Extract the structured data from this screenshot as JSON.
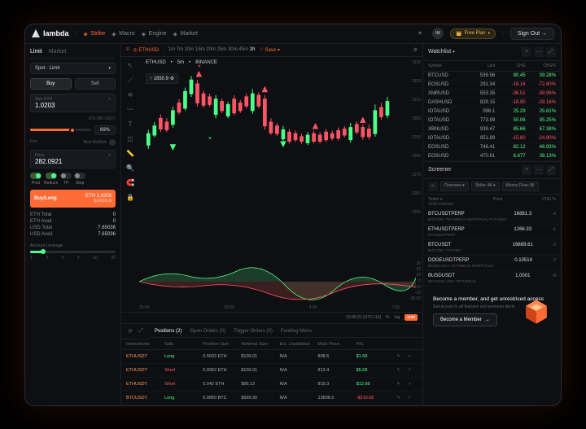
{
  "brand": "lambda",
  "nav": [
    {
      "label": "Strike",
      "active": true
    },
    {
      "label": "Macro"
    },
    {
      "label": "Engine"
    },
    {
      "label": "Market"
    }
  ],
  "user_initials": "IM",
  "plan_label": "Free Plan",
  "signout": "Sign Out",
  "order": {
    "tabs": [
      "Limit",
      "Market"
    ],
    "spot_label": "Spot · Limit",
    "buy": "Buy",
    "sell": "Sell",
    "size_label": "Size ETH",
    "size_value": "1.0203",
    "size_usd": "875.580 USDT",
    "slider_pct": "69%",
    "fee_label": "Fee",
    "bid_label": "Best Bid/Ask",
    "price_label": "Price",
    "price_value": "282.0921",
    "switches": [
      "Post",
      "Reduce",
      "TP",
      "Stop"
    ],
    "buy_long": "Buy/Long",
    "buy_long_pair": "ETH 1.0203",
    "buy_long_sub": "$1456.9",
    "stats": [
      {
        "k": "ETH Total",
        "v": "0"
      },
      {
        "k": "ETH Avail.",
        "v": "0"
      },
      {
        "k": "USD Total",
        "v": "7.65036"
      },
      {
        "k": "USD Avail.",
        "v": "7.65036"
      }
    ],
    "leverage_label": "Account Leverage",
    "leverage_marks": [
      "1",
      "2",
      "3",
      "5",
      "10",
      "20"
    ]
  },
  "timeframes": [
    "1m",
    "7m",
    "10m",
    "15m",
    "20m",
    "25m",
    "30m",
    "45m",
    "1h"
  ],
  "tf_save": "Save",
  "chart": {
    "symbol": "ETHUSD",
    "interval": "5m",
    "exchange": "BINANCE",
    "last_price": "1650.9",
    "y": [
      "1330",
      "1320",
      "1310",
      "1300",
      "1290",
      "1280",
      "1270",
      "1260",
      "1255"
    ],
    "y2": [
      "30",
      "20",
      "10",
      "0",
      "-10",
      "-20",
      "-30.00"
    ],
    "x": [
      "16:00",
      "20:00",
      "4:00",
      "7:00"
    ],
    "info_time": "23:45:01 (UTC+10)",
    "info_pct": "%",
    "info_log": "log",
    "info_auto": "auto"
  },
  "positions": {
    "tabs": [
      {
        "l": "Positions (2)",
        "a": true
      },
      {
        "l": "Open Orders (0)"
      },
      {
        "l": "Trigger Orders (0)"
      },
      {
        "l": "Funding Menu"
      }
    ],
    "cols": [
      "Instruments",
      "Side",
      "Position Size",
      "Notional Size",
      "Est. Liquidation",
      "Mark Price",
      "PnL",
      ""
    ],
    "rows": [
      {
        "inst": "ETHUSDT",
        "side": "Long",
        "psize": "0.0032 ETH",
        "nsize": "$100.01",
        "liq": "N/A",
        "mark": "808.5",
        "pnl": "$1.68",
        "pos": true
      },
      {
        "inst": "ETHUSDT",
        "side": "Short",
        "psize": "0.0052 ETH",
        "nsize": "$100.01",
        "liq": "N/A",
        "mark": "812.4",
        "pnl": "$5.68",
        "pos": true
      },
      {
        "inst": "ETHUSDT",
        "side": "Short",
        "psize": "0.042 ETH",
        "nsize": "$95.12",
        "liq": "N/A",
        "mark": "819.3",
        "pnl": "$12.68",
        "pos": true
      },
      {
        "inst": "BTCUSDT",
        "side": "Long",
        "psize": "0.0850 BTC",
        "nsize": "$999.90",
        "liq": "N/A",
        "mark": "13808.5",
        "pnl": "-$210.68",
        "pos": false
      }
    ]
  },
  "watchlist": {
    "title": "Watchlist",
    "cols": [
      "Symbol",
      "Last",
      "CHG",
      "CHG%"
    ],
    "rows": [
      {
        "s": "BTCUSD",
        "l": "539.56",
        "c": "80.45",
        "p": "39.28%",
        "pos": true
      },
      {
        "s": "EOSUSD",
        "l": "291.34",
        "c": "-18.16",
        "p": "-72.80%",
        "pos": false
      },
      {
        "s": "XMRUSD",
        "l": "553.35",
        "c": "-36.51",
        "p": "-39.96%",
        "pos": false
      },
      {
        "s": "DASHUSD",
        "l": "829.15",
        "c": "-18.90",
        "p": "-29.16%",
        "pos": false
      },
      {
        "s": "IOTAUSD",
        "l": "098.1",
        "c": "25.29",
        "p": "25.61%",
        "pos": true
      },
      {
        "s": "IOTAUSD",
        "l": "773.99",
        "c": "50.06",
        "p": "95.25%",
        "pos": true
      },
      {
        "s": "XBNUSD",
        "l": "939.47",
        "c": "85.66",
        "p": "67.38%",
        "pos": true
      },
      {
        "s": "IOTAUSD",
        "l": "951.89",
        "c": "-15.80",
        "p": "-24.90%",
        "pos": false
      },
      {
        "s": "EOSUSD",
        "l": "746.41",
        "c": "82.12",
        "p": "46.93%",
        "pos": true
      },
      {
        "s": "EOSUSD",
        "l": "470.61",
        "c": "6.677",
        "p": "38.13%",
        "pos": true
      }
    ]
  },
  "screener": {
    "title": "Screener",
    "filters": [
      "Overview ▾",
      "Strike: All ▾",
      "Money Flow: All"
    ],
    "ticker_label": "Ticker",
    "ticker_count": "1234 matches",
    "price_label": "Price",
    "chg_label": "CHG %",
    "rows": [
      {
        "t": "BTCUSDTPERP",
        "s": "BITCOIN / TETHERUS PERPETUAL FUTURES",
        "p": "16881.3",
        "c": "-2"
      },
      {
        "t": "ETHUSDTPERP",
        "s": "ETHUSDTPERP",
        "p": "1266.33",
        "c": "-1"
      },
      {
        "t": "BTCUSDT",
        "s": "BITCOIN / TETHER",
        "p": "16889.61",
        "c": "-2"
      },
      {
        "t": "DOGEUSDTPERP",
        "s": "DOGECOIN / TETHERUS PERPETUAL",
        "p": "0.10514",
        "c": "2"
      },
      {
        "t": "BUSDUSDT",
        "s": "BINANCE USD / TETHERUS",
        "p": "1.0001",
        "c": "-0"
      }
    ]
  },
  "member": {
    "title": "Become a member, and get unrestriced access",
    "sub": "Get access to all features and premium alerts",
    "btn": "Become a Member"
  }
}
